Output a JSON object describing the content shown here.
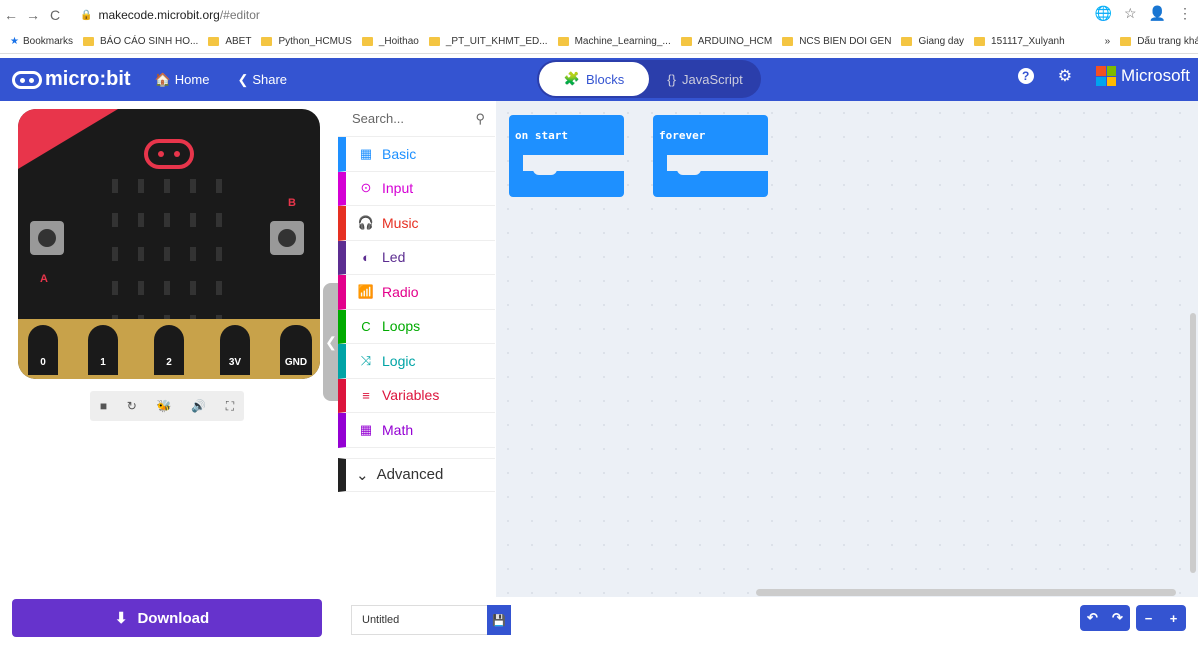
{
  "browser": {
    "back": "←",
    "forward": "→",
    "reload": "C",
    "url_host": "makecode.microbit.org",
    "url_path": "/#editor",
    "right_icons": [
      "🌐",
      "☆",
      "👤",
      "⋮"
    ]
  },
  "bookmarks": {
    "label": "Bookmarks",
    "items": [
      "BÁO CÁO SINH HO...",
      "ABET",
      "Python_HCMUS",
      "_Hoithao",
      "_PT_UIT_KHMT_ED...",
      "Machine_Learning_...",
      "ARDUINO_HCM",
      "NCS BIEN DOI GEN",
      "Giang day",
      "151117_Xulyanh"
    ],
    "more": "»",
    "other": "Dấu trang khác"
  },
  "topbar": {
    "logo": "micro:bit",
    "home": "Home",
    "share": "Share",
    "tab_blocks": "Blocks",
    "tab_js": "JavaScript",
    "help": "?",
    "settings": "⚙",
    "brand": "Microsoft"
  },
  "simulator": {
    "label_a": "A",
    "label_b": "B",
    "pins": [
      "0",
      "1",
      "2",
      "3V",
      "GND"
    ],
    "controls": [
      "■",
      "↻",
      "🐝",
      "🔊",
      "⛶"
    ]
  },
  "toolbox": {
    "search_placeholder": "Search...",
    "categories": [
      {
        "label": "Basic",
        "color": "#1e90ff",
        "icon": "▦"
      },
      {
        "label": "Input",
        "color": "#d400d4",
        "icon": "⊙"
      },
      {
        "label": "Music",
        "color": "#e63022",
        "icon": "🎧"
      },
      {
        "label": "Led",
        "color": "#5c2d91",
        "icon": "◐"
      },
      {
        "label": "Radio",
        "color": "#e3008c",
        "icon": "📶"
      },
      {
        "label": "Loops",
        "color": "#00aa00",
        "icon": "C"
      },
      {
        "label": "Logic",
        "color": "#00a4a6",
        "icon": "⤨"
      },
      {
        "label": "Variables",
        "color": "#dc143c",
        "icon": "≡"
      },
      {
        "label": "Math",
        "color": "#9400d3",
        "icon": "▦"
      }
    ],
    "advanced": "Advanced"
  },
  "workspace": {
    "blocks": [
      "on start",
      "forever"
    ]
  },
  "bottombar": {
    "download": "Download",
    "project_name": "Untitled",
    "undo": "↶",
    "redo": "↷",
    "zoom_out": "−",
    "zoom_in": "+"
  },
  "colors": {
    "accent": "#3454d1",
    "download": "#6633cc",
    "block": "#1e90ff"
  }
}
